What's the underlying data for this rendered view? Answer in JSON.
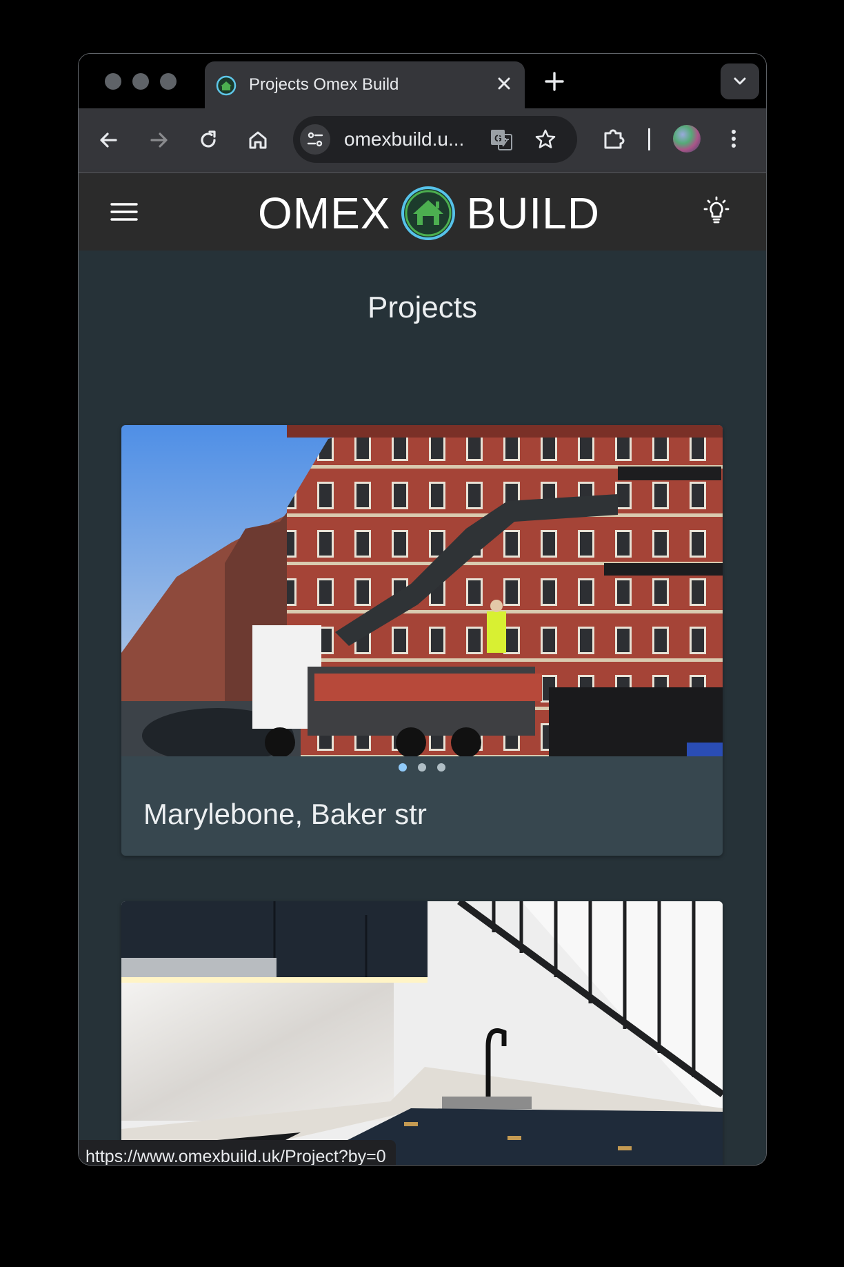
{
  "tab": {
    "title": "Projects Omex Build"
  },
  "omnibox": {
    "url": "omexbuild.u..."
  },
  "site": {
    "logo_left": "OMEX",
    "logo_right": "BUILD",
    "brand_green": "#4caf50"
  },
  "page": {
    "title": "Projects"
  },
  "projects": [
    {
      "title": "Marylebone, Baker str",
      "slides": 3,
      "active_slide": 1
    },
    {
      "title": ""
    }
  ],
  "statusbar": {
    "url": "https://www.omexbuild.uk/Project?by=0"
  },
  "icons": {
    "back": "back-arrow-icon",
    "forward": "forward-arrow-icon",
    "reload": "reload-icon",
    "home": "home-icon",
    "tune": "site-settings-icon",
    "translate": "translate-icon",
    "star": "bookmark-star-icon",
    "extensions": "puzzle-icon",
    "menu": "kebab-menu-icon",
    "hamburger": "hamburger-menu-icon",
    "theme": "lightbulb-icon"
  }
}
